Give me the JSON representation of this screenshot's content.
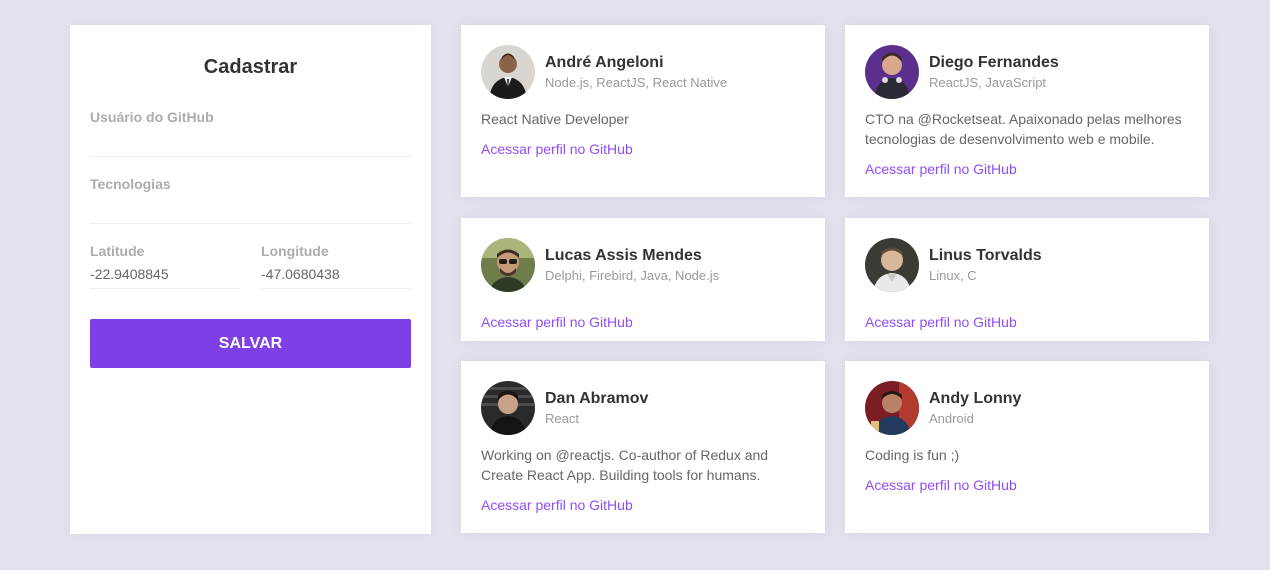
{
  "form": {
    "title": "Cadastrar",
    "github_label": "Usuário do GitHub",
    "github_value": "",
    "techs_label": "Tecnologias",
    "techs_value": "",
    "latitude_label": "Latitude",
    "latitude_value": "-22.9408845",
    "longitude_label": "Longitude",
    "longitude_value": "-47.0680438",
    "save_label": "SALVAR"
  },
  "colors": {
    "accent": "#7d40e7",
    "link": "#8e4dff",
    "background": "#e2e2ef"
  },
  "devs": [
    {
      "name": "André Angeloni",
      "techs": "Node.js, ReactJS, React Native",
      "bio": "React Native Developer",
      "link": "Acessar perfil no GitHub"
    },
    {
      "name": "Diego Fernandes",
      "techs": "ReactJS, JavaScript",
      "bio": "CTO na @Rocketseat. Apaixonado pelas melhores tecnologias de desenvolvimento web e mobile.",
      "link": "Acessar perfil no GitHub"
    },
    {
      "name": "Lucas Assis Mendes",
      "techs": "Delphi, Firebird, Java, Node.js",
      "bio": "",
      "link": "Acessar perfil no GitHub"
    },
    {
      "name": "Linus Torvalds",
      "techs": "Linux, C",
      "bio": "",
      "link": "Acessar perfil no GitHub"
    },
    {
      "name": "Dan Abramov",
      "techs": "React",
      "bio": "Working on @reactjs. Co-author of Redux and Create React App. Building tools for humans.",
      "link": "Acessar perfil no GitHub"
    },
    {
      "name": "Andy Lonny",
      "techs": "Android",
      "bio": "Coding is fun ;)",
      "link": "Acessar perfil no GitHub"
    }
  ]
}
